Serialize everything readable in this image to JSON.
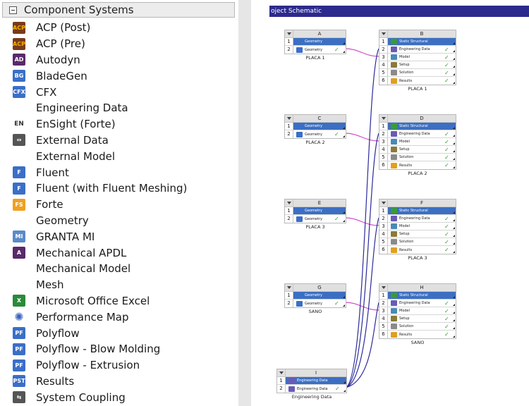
{
  "toolbox": {
    "title": "Component Systems",
    "items": [
      {
        "label": "ACP (Post)",
        "icon": "acp-icon",
        "icon_text": "ACP",
        "color": "#7a3a18",
        "fg": "#f2b200",
        "kind": "text"
      },
      {
        "label": "ACP (Pre)",
        "icon": "acp-icon",
        "icon_text": "ACP",
        "color": "#7a3a18",
        "fg": "#f2b200",
        "kind": "text"
      },
      {
        "label": "Autodyn",
        "icon": "autodyn-icon",
        "icon_text": "AD",
        "color": "#5a2a6a",
        "fg": "#ffffff",
        "kind": "text"
      },
      {
        "label": "BladeGen",
        "icon": "bladegen-icon",
        "icon_text": "BG",
        "color": "#3a6fc8",
        "fg": "#ffffff",
        "kind": "text"
      },
      {
        "label": "CFX",
        "icon": "cfx-icon",
        "icon_text": "CFX",
        "color": "#3a6fc8",
        "fg": "#ffffff",
        "kind": "text"
      },
      {
        "label": "Engineering Data",
        "icon": "engineering-data-book-icon",
        "icon_text": "",
        "color": "#6a5ab8",
        "fg": "#ffffff",
        "kind": "book"
      },
      {
        "label": "EnSight (Forte)",
        "icon": "ensight-icon",
        "icon_text": "EN",
        "color": "#ffffff",
        "fg": "#333333",
        "kind": "en"
      },
      {
        "label": "External Data",
        "icon": "external-data-icon",
        "icon_text": "⇔",
        "color": "#555555",
        "fg": "#ffffff",
        "kind": "text"
      },
      {
        "label": "External Model",
        "icon": "external-model-icon",
        "icon_text": "",
        "color": "#4a8ab8",
        "fg": "#ffffff",
        "kind": "cube"
      },
      {
        "label": "Fluent",
        "icon": "fluent-icon",
        "icon_text": "F",
        "color": "#3a6fc8",
        "fg": "#ffffff",
        "kind": "text"
      },
      {
        "label": "Fluent (with Fluent Meshing)",
        "icon": "fluent-meshing-icon",
        "icon_text": "F",
        "color": "#3a6fc8",
        "fg": "#ffffff",
        "kind": "text"
      },
      {
        "label": "Forte",
        "icon": "forte-icon",
        "icon_text": "FS",
        "color": "#f0a020",
        "fg": "#ffffff",
        "kind": "text"
      },
      {
        "label": "Geometry",
        "icon": "geometry-icon",
        "icon_text": "",
        "color": "#b8a070",
        "fg": "#ffffff",
        "kind": "cube"
      },
      {
        "label": "GRANTA MI",
        "icon": "granta-icon",
        "icon_text": "MI",
        "color": "#5a8ac8",
        "fg": "#ffffff",
        "kind": "text"
      },
      {
        "label": "Mechanical APDL",
        "icon": "apdl-icon",
        "icon_text": "A",
        "color": "#5a2a6a",
        "fg": "#ffffff",
        "kind": "text"
      },
      {
        "label": "Mechanical Model",
        "icon": "mechanical-model-icon",
        "icon_text": "",
        "color": "#4a8ab8",
        "fg": "#ffffff",
        "kind": "cube"
      },
      {
        "label": "Mesh",
        "icon": "mesh-icon",
        "icon_text": "",
        "color": "#a89060",
        "fg": "#ffffff",
        "kind": "cube"
      },
      {
        "label": "Microsoft Office Excel",
        "icon": "excel-icon",
        "icon_text": "X",
        "color": "#2a8a3a",
        "fg": "#ffffff",
        "kind": "text"
      },
      {
        "label": "Performance Map",
        "icon": "performance-map-icon",
        "icon_text": "✺",
        "color": "#ffffff",
        "fg": "#3a63c0",
        "kind": "fan"
      },
      {
        "label": "Polyflow",
        "icon": "polyflow-icon",
        "icon_text": "PF",
        "color": "#3a6fc8",
        "fg": "#ffffff",
        "kind": "text"
      },
      {
        "label": "Polyflow - Blow Molding",
        "icon": "polyflow-blow-icon",
        "icon_text": "PF",
        "color": "#3a6fc8",
        "fg": "#ffffff",
        "kind": "text"
      },
      {
        "label": "Polyflow - Extrusion",
        "icon": "polyflow-extrusion-icon",
        "icon_text": "PF",
        "color": "#3a6fc8",
        "fg": "#ffffff",
        "kind": "text"
      },
      {
        "label": "Results",
        "icon": "results-icon",
        "icon_text": "PST",
        "color": "#3a6fc8",
        "fg": "#ffffff",
        "kind": "text"
      },
      {
        "label": "System Coupling",
        "icon": "system-coupling-icon",
        "icon_text": "⇆",
        "color": "#555555",
        "fg": "#ffffff",
        "kind": "text"
      }
    ]
  },
  "schematic": {
    "title": "oject Schematic",
    "cell_colors": {
      "Static Structural": "#3a9a3a",
      "Engineering Data": "#6a5ab8",
      "Geometry": "#3a6fc8",
      "Model": "#4a8ab8",
      "Setup": "#8a7a3a",
      "Solution": "#8a8a8a",
      "Results": "#e0a020"
    },
    "systems": [
      {
        "id": "A",
        "letter": "A",
        "name": "PLACA 1",
        "cells": [
          {
            "num": "1",
            "label": "Geometry",
            "sel": true,
            "check": ""
          },
          {
            "num": "2",
            "label": "Geometry",
            "sel": false,
            "check": "✓"
          }
        ]
      },
      {
        "id": "B",
        "letter": "B",
        "name": "PLACA 1",
        "cells": [
          {
            "num": "1",
            "label": "Static Structural",
            "sel": true,
            "check": ""
          },
          {
            "num": "2",
            "label": "Engineering Data",
            "sel": false,
            "check": "✓"
          },
          {
            "num": "3",
            "label": "Model",
            "sel": false,
            "check": "✓"
          },
          {
            "num": "4",
            "label": "Setup",
            "sel": false,
            "check": "✓"
          },
          {
            "num": "5",
            "label": "Solution",
            "sel": false,
            "check": "✓"
          },
          {
            "num": "6",
            "label": "Results",
            "sel": false,
            "check": "✓"
          }
        ]
      },
      {
        "id": "C",
        "letter": "C",
        "name": "PLACA 2",
        "cells": [
          {
            "num": "1",
            "label": "Geometry",
            "sel": true,
            "check": ""
          },
          {
            "num": "2",
            "label": "Geometry",
            "sel": false,
            "check": "✓"
          }
        ]
      },
      {
        "id": "D",
        "letter": "D",
        "name": "PLACA 2",
        "cells": [
          {
            "num": "1",
            "label": "Static Structural",
            "sel": true,
            "check": ""
          },
          {
            "num": "2",
            "label": "Engineering Data",
            "sel": false,
            "check": "✓"
          },
          {
            "num": "3",
            "label": "Model",
            "sel": false,
            "check": "✓"
          },
          {
            "num": "4",
            "label": "Setup",
            "sel": false,
            "check": "✓"
          },
          {
            "num": "5",
            "label": "Solution",
            "sel": false,
            "check": "✓"
          },
          {
            "num": "6",
            "label": "Results",
            "sel": false,
            "check": "✓"
          }
        ]
      },
      {
        "id": "E",
        "letter": "E",
        "name": "PLACA 3",
        "cells": [
          {
            "num": "1",
            "label": "Geometry",
            "sel": true,
            "check": ""
          },
          {
            "num": "2",
            "label": "Geometry",
            "sel": false,
            "check": "✓"
          }
        ]
      },
      {
        "id": "F",
        "letter": "F",
        "name": "PLACA 3",
        "cells": [
          {
            "num": "1",
            "label": "Static Structural",
            "sel": true,
            "check": ""
          },
          {
            "num": "2",
            "label": "Engineering Data",
            "sel": false,
            "check": "✓"
          },
          {
            "num": "3",
            "label": "Model",
            "sel": false,
            "check": "✓"
          },
          {
            "num": "4",
            "label": "Setup",
            "sel": false,
            "check": "✓"
          },
          {
            "num": "5",
            "label": "Solution",
            "sel": false,
            "check": "✓"
          },
          {
            "num": "6",
            "label": "Results",
            "sel": false,
            "check": "✓"
          }
        ]
      },
      {
        "id": "G",
        "letter": "G",
        "name": "SANO",
        "cells": [
          {
            "num": "1",
            "label": "Geometry",
            "sel": true,
            "check": ""
          },
          {
            "num": "2",
            "label": "Geometry",
            "sel": false,
            "check": "✓"
          }
        ]
      },
      {
        "id": "H",
        "letter": "H",
        "name": "SANO",
        "cells": [
          {
            "num": "1",
            "label": "Static Structural",
            "sel": true,
            "check": ""
          },
          {
            "num": "2",
            "label": "Engineering Data",
            "sel": false,
            "check": "✓"
          },
          {
            "num": "3",
            "label": "Model",
            "sel": false,
            "check": "✓"
          },
          {
            "num": "4",
            "label": "Setup",
            "sel": false,
            "check": "✓"
          },
          {
            "num": "5",
            "label": "Solution",
            "sel": false,
            "check": "✓"
          },
          {
            "num": "6",
            "label": "Results",
            "sel": false,
            "check": "✓"
          }
        ]
      },
      {
        "id": "I",
        "letter": "I",
        "name": "Engineering Data",
        "cells": [
          {
            "num": "1",
            "label": "Engineering Data",
            "sel": true,
            "check": ""
          },
          {
            "num": "2",
            "label": "Engineering Data",
            "sel": false,
            "check": "✓"
          }
        ]
      }
    ],
    "wire_colors": {
      "geometry_link": "#d04ac8",
      "data_link": "#2a2a9a"
    }
  }
}
